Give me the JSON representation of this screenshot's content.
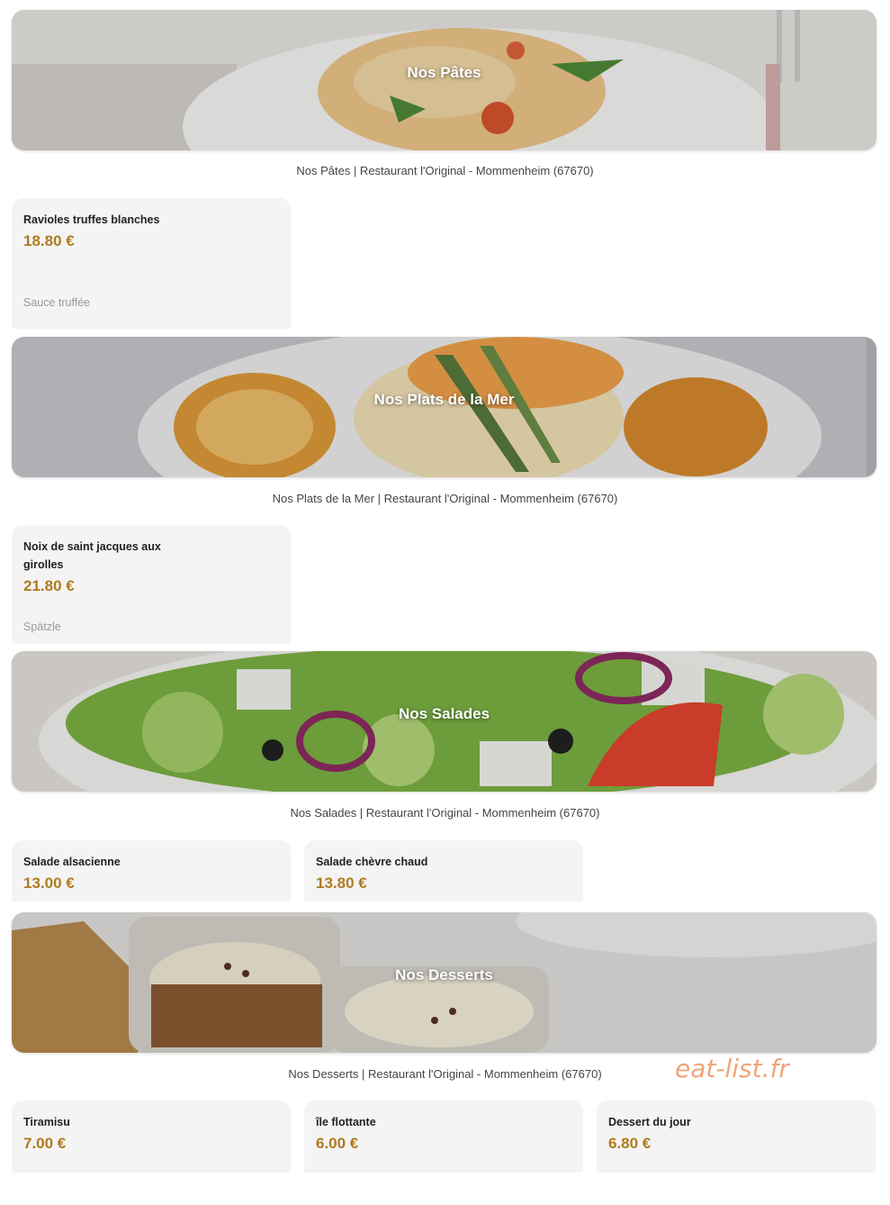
{
  "sections": [
    {
      "title": "Nos Pâtes",
      "caption": "Nos Pâtes | Restaurant l'Original - Mommenheim (67670)",
      "items": [
        {
          "name": "Ravioles truffes blanches",
          "price": "18.80 €",
          "desc": "Sauce truffée"
        }
      ]
    },
    {
      "title": "Nos Plats de la Mer",
      "caption": "Nos Plats de la Mer | Restaurant l'Original - Mommenheim (67670)",
      "items": [
        {
          "name": "Noix de saint jacques aux girolles",
          "price": "21.80 €",
          "desc": "Spätzle"
        }
      ]
    },
    {
      "title": "Nos Salades",
      "caption": "Nos Salades | Restaurant l'Original - Mommenheim (67670)",
      "items": [
        {
          "name": "Salade alsacienne",
          "price": "13.00 €"
        },
        {
          "name": "Salade chèvre chaud",
          "price": "13.80 €"
        }
      ]
    },
    {
      "title": "Nos Desserts",
      "caption": "Nos Desserts | Restaurant l'Original - Mommenheim (67670)",
      "items": [
        {
          "name": "Tiramisu",
          "price": "7.00 €"
        },
        {
          "name": "île flottante",
          "price": "6.00 €"
        },
        {
          "name": "Dessert du jour",
          "price": "6.80 €"
        }
      ]
    }
  ],
  "watermark": "eat-list.fr",
  "colors": {
    "price": "#b07a1f",
    "card_bg": "#f4f4f4",
    "watermark": "#f0a57a"
  }
}
